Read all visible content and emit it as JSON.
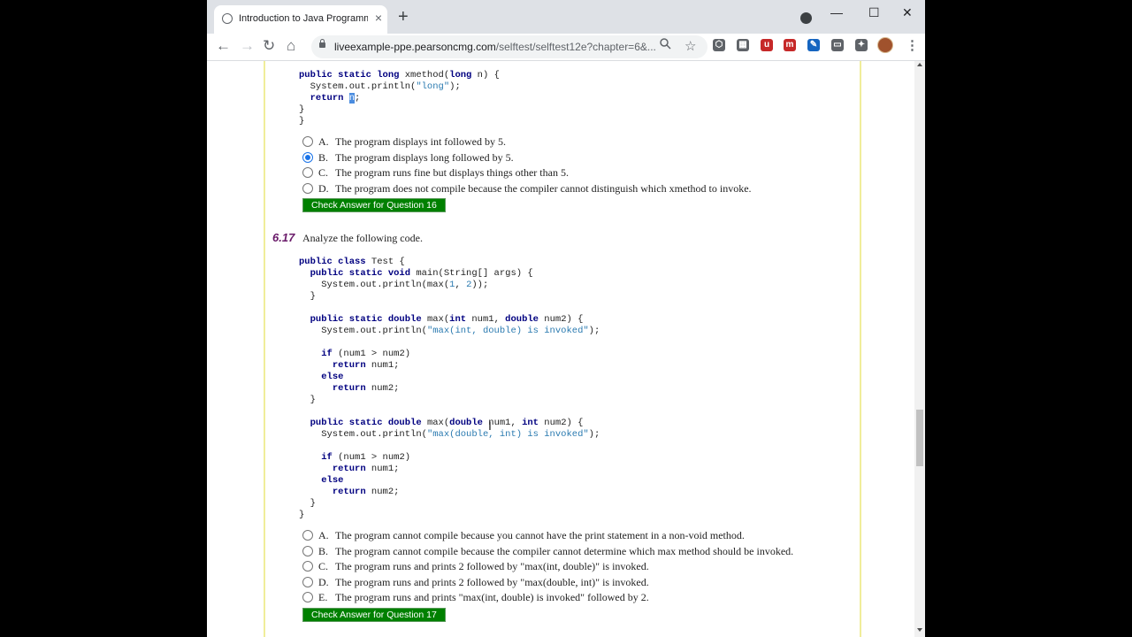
{
  "browser": {
    "tab_title": "Introduction to Java Programming",
    "tab_close": "×",
    "new_tab": "+",
    "window_controls": {
      "minimize": "—",
      "maximize": "☐",
      "close": "✕"
    },
    "nav": {
      "back": "←",
      "forward": "→",
      "reload": "↻",
      "home": "⌂"
    },
    "url_host": "liveexample-ppe.pearsoncmg.com",
    "url_path": "/selftest/selftest12e?chapter=6&...",
    "zoom_icon": "search-icon",
    "star_icon": "☆",
    "extensions": [
      {
        "name": "ext-cube-icon",
        "label": "⬡",
        "color": "#5f6368"
      },
      {
        "name": "ext-grid-icon",
        "label": "▦",
        "color": "#5f6368"
      },
      {
        "name": "ext-ublock-icon",
        "label": "u",
        "color": "#c62828"
      },
      {
        "name": "ext-m-icon",
        "label": "m",
        "color": "#c62828"
      },
      {
        "name": "ext-edit-icon",
        "label": "✎",
        "color": "#1565c0"
      },
      {
        "name": "ext-screen-icon",
        "label": "▭",
        "color": "#5f6368"
      },
      {
        "name": "ext-puzzle-icon",
        "label": "✦",
        "color": "#5f6368"
      }
    ],
    "menu": "⋮"
  },
  "q16": {
    "code": [
      "  public static long xmethod(long n) {",
      "    System.out.println(\"long\");",
      "    return n;",
      "  }",
      "}"
    ],
    "options": [
      {
        "letter": "A.",
        "text": "The program displays int followed by 5.",
        "checked": false
      },
      {
        "letter": "B.",
        "text": "The program displays long followed by 5.",
        "checked": true
      },
      {
        "letter": "C.",
        "text": "The program runs fine but displays things other than 5.",
        "checked": false
      },
      {
        "letter": "D.",
        "text": "The program does not compile because the compiler cannot distinguish which xmethod to invoke.",
        "checked": false
      }
    ],
    "button": "Check Answer for Question 16"
  },
  "q17": {
    "number": "6.17",
    "prompt": "Analyze the following code.",
    "options": [
      {
        "letter": "A.",
        "text": "The program cannot compile because you cannot have the print statement in a non-void method."
      },
      {
        "letter": "B.",
        "text": "The program cannot compile because the compiler cannot determine which max method should be invoked."
      },
      {
        "letter": "C.",
        "text": "The program runs and prints 2 followed by \"max(int, double)\" is invoked."
      },
      {
        "letter": "D.",
        "text": "The program runs and prints 2 followed by \"max(double, int)\" is invoked."
      },
      {
        "letter": "E.",
        "text": "The program runs and prints \"max(int, double) is invoked\" followed by 2."
      }
    ],
    "button": "Check Answer for Question 17"
  }
}
